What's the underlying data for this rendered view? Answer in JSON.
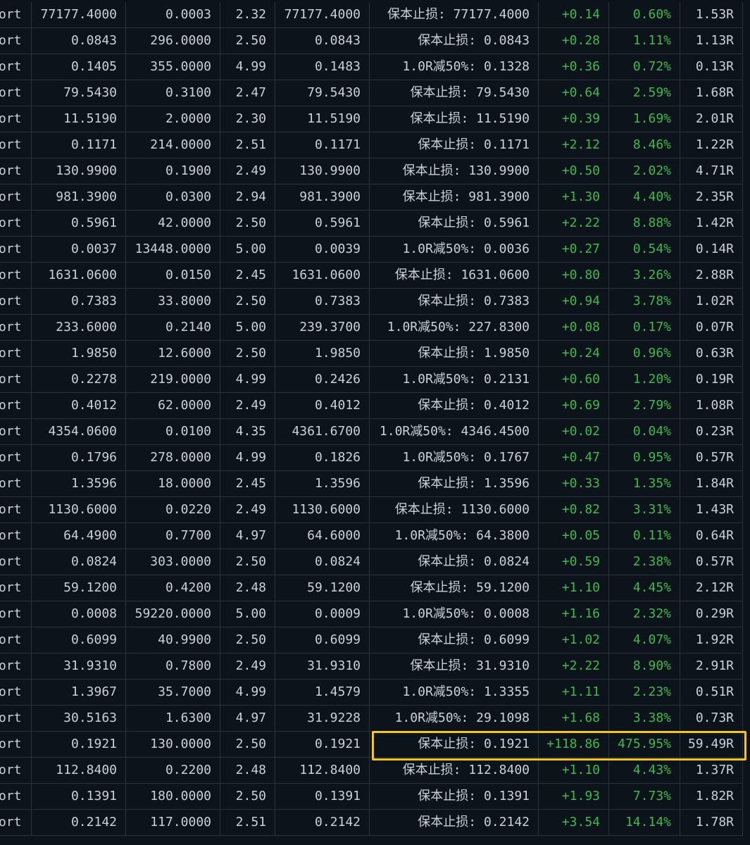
{
  "rows": [
    [
      "ort",
      "77177.4000",
      "0.0003",
      "2.32",
      "77177.4000",
      "保本止损: 77177.4000",
      "+0.14",
      "0.60%",
      "1.53R"
    ],
    [
      "ort",
      "0.0843",
      "296.0000",
      "2.50",
      "0.0843",
      "保本止损: 0.0843",
      "+0.28",
      "1.11%",
      "1.13R"
    ],
    [
      "ort",
      "0.1405",
      "355.0000",
      "4.99",
      "0.1483",
      "1.0R减50%: 0.1328",
      "+0.36",
      "0.72%",
      "0.13R"
    ],
    [
      "ort",
      "79.5430",
      "0.3100",
      "2.47",
      "79.5430",
      "保本止损: 79.5430",
      "+0.64",
      "2.59%",
      "1.68R"
    ],
    [
      "ort",
      "11.5190",
      "2.0000",
      "2.30",
      "11.5190",
      "保本止损: 11.5190",
      "+0.39",
      "1.69%",
      "2.01R"
    ],
    [
      "ort",
      "0.1171",
      "214.0000",
      "2.51",
      "0.1171",
      "保本止损: 0.1171",
      "+2.12",
      "8.46%",
      "1.22R"
    ],
    [
      "ort",
      "130.9900",
      "0.1900",
      "2.49",
      "130.9900",
      "保本止损: 130.9900",
      "+0.50",
      "2.02%",
      "4.71R"
    ],
    [
      "ort",
      "981.3900",
      "0.0300",
      "2.94",
      "981.3900",
      "保本止损: 981.3900",
      "+1.30",
      "4.40%",
      "2.35R"
    ],
    [
      "ort",
      "0.5961",
      "42.0000",
      "2.50",
      "0.5961",
      "保本止损: 0.5961",
      "+2.22",
      "8.88%",
      "1.42R"
    ],
    [
      "ort",
      "0.0037",
      "13448.0000",
      "5.00",
      "0.0039",
      "1.0R减50%: 0.0036",
      "+0.27",
      "0.54%",
      "0.14R"
    ],
    [
      "ort",
      "1631.0600",
      "0.0150",
      "2.45",
      "1631.0600",
      "保本止损: 1631.0600",
      "+0.80",
      "3.26%",
      "2.88R"
    ],
    [
      "ort",
      "0.7383",
      "33.8000",
      "2.50",
      "0.7383",
      "保本止损: 0.7383",
      "+0.94",
      "3.78%",
      "1.02R"
    ],
    [
      "ort",
      "233.6000",
      "0.2140",
      "5.00",
      "239.3700",
      "1.0R减50%: 227.8300",
      "+0.08",
      "0.17%",
      "0.07R"
    ],
    [
      "ort",
      "1.9850",
      "12.6000",
      "2.50",
      "1.9850",
      "保本止损: 1.9850",
      "+0.24",
      "0.96%",
      "0.63R"
    ],
    [
      "ort",
      "0.2278",
      "219.0000",
      "4.99",
      "0.2426",
      "1.0R减50%: 0.2131",
      "+0.60",
      "1.20%",
      "0.19R"
    ],
    [
      "ort",
      "0.4012",
      "62.0000",
      "2.49",
      "0.4012",
      "保本止损: 0.4012",
      "+0.69",
      "2.79%",
      "1.08R"
    ],
    [
      "ort",
      "4354.0600",
      "0.0100",
      "4.35",
      "4361.6700",
      "1.0R减50%: 4346.4500",
      "+0.02",
      "0.04%",
      "0.23R"
    ],
    [
      "ort",
      "0.1796",
      "278.0000",
      "4.99",
      "0.1826",
      "1.0R减50%: 0.1767",
      "+0.47",
      "0.95%",
      "0.57R"
    ],
    [
      "ort",
      "1.3596",
      "18.0000",
      "2.45",
      "1.3596",
      "保本止损: 1.3596",
      "+0.33",
      "1.35%",
      "1.84R"
    ],
    [
      "ort",
      "1130.6000",
      "0.0220",
      "2.49",
      "1130.6000",
      "保本止损: 1130.6000",
      "+0.82",
      "3.31%",
      "1.43R"
    ],
    [
      "ort",
      "64.4900",
      "0.7700",
      "4.97",
      "64.6000",
      "1.0R减50%: 64.3800",
      "+0.05",
      "0.11%",
      "0.64R"
    ],
    [
      "ort",
      "0.0824",
      "303.0000",
      "2.50",
      "0.0824",
      "保本止损: 0.0824",
      "+0.59",
      "2.38%",
      "0.57R"
    ],
    [
      "ort",
      "59.1200",
      "0.4200",
      "2.48",
      "59.1200",
      "保本止损: 59.1200",
      "+1.10",
      "4.45%",
      "2.12R"
    ],
    [
      "ort",
      "0.0008",
      "59220.0000",
      "5.00",
      "0.0009",
      "1.0R减50%: 0.0008",
      "+1.16",
      "2.32%",
      "0.29R"
    ],
    [
      "ort",
      "0.6099",
      "40.9900",
      "2.50",
      "0.6099",
      "保本止损: 0.6099",
      "+1.02",
      "4.07%",
      "1.92R"
    ],
    [
      "ort",
      "31.9310",
      "0.7800",
      "2.49",
      "31.9310",
      "保本止损: 31.9310",
      "+2.22",
      "8.90%",
      "2.91R"
    ],
    [
      "ort",
      "1.3967",
      "35.7000",
      "4.99",
      "1.4579",
      "1.0R减50%: 1.3355",
      "+1.11",
      "2.23%",
      "0.51R"
    ],
    [
      "ort",
      "30.5163",
      "1.6300",
      "4.97",
      "31.9228",
      "1.0R减50%: 29.1098",
      "+1.68",
      "3.38%",
      "0.73R"
    ],
    [
      "ort",
      "0.1921",
      "130.0000",
      "2.50",
      "0.1921",
      "保本止损: 0.1921",
      "+118.86",
      "475.95%",
      "59.49R"
    ],
    [
      "ort",
      "112.8400",
      "0.2200",
      "2.48",
      "112.8400",
      "保本止损: 112.8400",
      "+1.10",
      "4.43%",
      "1.37R"
    ],
    [
      "ort",
      "0.1391",
      "180.0000",
      "2.50",
      "0.1391",
      "保本止损: 0.1391",
      "+1.93",
      "7.73%",
      "1.82R"
    ],
    [
      "ort",
      "0.2142",
      "117.0000",
      "2.51",
      "0.2142",
      "保本止损: 0.2142",
      "+3.54",
      "14.14%",
      "1.78R"
    ]
  ],
  "colors": {
    "background": "#0d131a",
    "text": "#c9d1d9",
    "positive": "#3fb950",
    "highlight": "#f5c518",
    "grid": "#2a323c"
  }
}
